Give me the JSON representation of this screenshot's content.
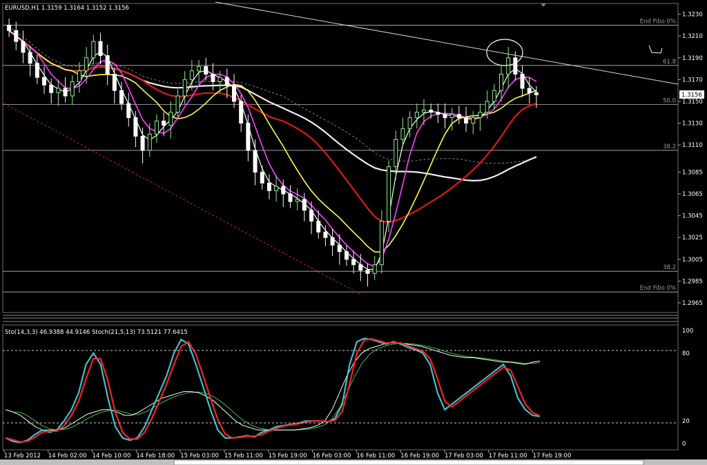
{
  "window": {
    "symbol_header": "EURUSD,H1  1.3159 1.3164 1.3152 1.3156",
    "indicator_header": "Sto(14,3,3) 46.9388 44.9146  Stoch(21,5,13) 73.5121 77.6415",
    "current_price": "1.3156"
  },
  "fibo_labels": [
    {
      "text": "End Fibo 0%",
      "price": 1.322
    },
    {
      "text": "61.8",
      "price": 1.3183
    },
    {
      "text": "50.0",
      "price": 1.3147
    },
    {
      "text": "38.2",
      "price": 1.3105
    },
    {
      "text": "38.2",
      "price": 1.2994
    },
    {
      "text": "End Fibo 0%",
      "price": 1.2975
    }
  ],
  "colors": {
    "background": "#000000",
    "up_candle": "#90ee90",
    "down_candle": "#ffffff",
    "ma_fast": "#ffffff",
    "ma_mid": "#ff40ff",
    "ma_yellow": "#ffff40",
    "ma_red": "#e01818",
    "ma_white_slow": "#f0f0f0",
    "stoch_main": "#40c0d0",
    "stoch_signal": "#ff2020",
    "stoch_slow_main": "#ffffff",
    "stoch_slow_signal": "#40c040"
  },
  "chart_data": [
    {
      "type": "line",
      "title": "EURUSD,H1",
      "y_ticks": [
        "1.3230",
        "1.3210",
        "1.3190",
        "1.3170",
        "1.3150",
        "1.3130",
        "1.3110",
        "1.3085",
        "1.3065",
        "1.3045",
        "1.3025",
        "1.3005",
        "1.2985",
        "1.2965"
      ],
      "ylim": [
        1.2958,
        1.3238
      ],
      "x_ticks": [
        "13 Feb 2012",
        "14 Feb 02:00",
        "14 Feb 10:00",
        "14 Feb 18:00",
        "15 Feb 03:00",
        "15 Feb 11:00",
        "15 Feb 19:00",
        "16 Feb 03:00",
        "16 Feb 11:00",
        "16 Feb 19:00",
        "17 Feb 03:00",
        "17 Feb 11:00",
        "17 Feb 19:00"
      ],
      "series": [
        {
          "name": "close",
          "values": [
            1.3215,
            1.3205,
            1.3195,
            1.3185,
            1.3172,
            1.3165,
            1.3158,
            1.3162,
            1.3155,
            1.3168,
            1.3178,
            1.319,
            1.3205,
            1.3192,
            1.3175,
            1.316,
            1.3148,
            1.3135,
            1.3118,
            1.3105,
            1.312,
            1.3132,
            1.3128,
            1.314,
            1.3155,
            1.317,
            1.3178,
            1.3182,
            1.3175,
            1.3168,
            1.3172,
            1.3165,
            1.315,
            1.313,
            1.3105,
            1.3085,
            1.3075,
            1.3068,
            1.3072,
            1.3065,
            1.3058,
            1.306,
            1.305,
            1.304,
            1.303,
            1.3025,
            1.3018,
            1.3012,
            1.3005,
            1.3,
            1.2995,
            1.2992,
            1.3,
            1.304,
            1.309,
            1.3115,
            1.3125,
            1.3135,
            1.314,
            1.3142,
            1.314,
            1.3138,
            1.3135,
            1.3138,
            1.3135,
            1.313,
            1.3135,
            1.314,
            1.315,
            1.316,
            1.3175,
            1.319,
            1.3175,
            1.3162,
            1.3158,
            1.3156
          ]
        }
      ]
    },
    {
      "type": "line",
      "title": "Sto(14,3,3) 46.9388 44.9146  Stoch(21,5,13) 73.5121 77.6415",
      "y_ticks": [
        "100",
        "80",
        "20",
        "0"
      ],
      "ylim": [
        0,
        100
      ],
      "series": [
        {
          "name": "Sto(14,3,3)",
          "values": [
            5,
            2,
            1,
            3,
            8,
            12,
            10,
            12,
            20,
            30,
            45,
            70,
            80,
            70,
            40,
            15,
            5,
            3,
            5,
            15,
            30,
            45,
            60,
            80,
            92,
            88,
            70,
            50,
            30,
            12,
            5,
            5,
            6,
            7,
            6,
            10,
            12,
            15,
            16,
            17,
            18,
            20,
            20,
            20,
            19,
            22,
            35,
            70,
            90,
            93,
            92,
            90,
            88,
            90,
            88,
            85,
            83,
            80,
            70,
            45,
            30,
            35,
            40,
            45,
            50,
            55,
            60,
            65,
            70,
            60,
            40,
            30,
            25,
            24
          ]
        },
        {
          "name": "Stoch(21,5,13)",
          "values": [
            30,
            28,
            25,
            20,
            15,
            12,
            12,
            12,
            14,
            18,
            22,
            26,
            28,
            30,
            30,
            28,
            25,
            25,
            28,
            32,
            36,
            40,
            42,
            44,
            46,
            46,
            45,
            42,
            38,
            32,
            26,
            20,
            16,
            14,
            12,
            12,
            12,
            12,
            12,
            12,
            13,
            14,
            16,
            20,
            30,
            45,
            60,
            72,
            80,
            84,
            86,
            88,
            89,
            89,
            88,
            87,
            86,
            84,
            82,
            80,
            78,
            77,
            76,
            76,
            75,
            74,
            73,
            72,
            72,
            71,
            70,
            72,
            73
          ]
        }
      ]
    }
  ]
}
